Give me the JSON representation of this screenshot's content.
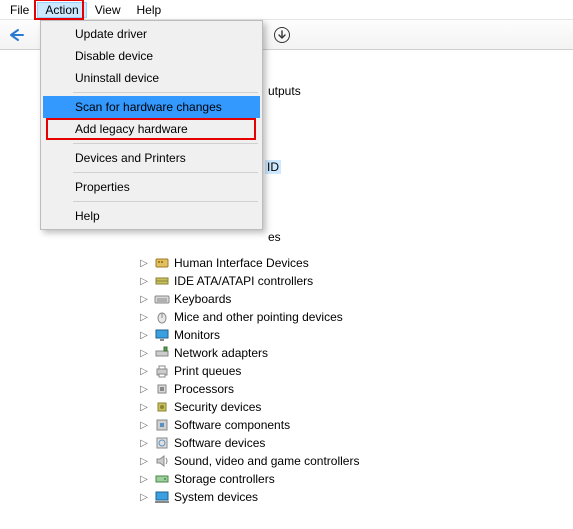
{
  "menubar": {
    "file": "File",
    "action": "Action",
    "view": "View",
    "help": "Help"
  },
  "dropdown": {
    "update": "Update driver",
    "disable": "Disable device",
    "uninstall": "Uninstall device",
    "scan": "Scan for hardware changes",
    "addlegacy": "Add legacy hardware",
    "devprint": "Devices and Printers",
    "properties": "Properties",
    "help": "Help"
  },
  "peeks": {
    "outputs": "utputs",
    "selected_fragment": "ID",
    "es_suffix": "es"
  },
  "tree": [
    {
      "label": "Human Interface Devices",
      "icon": "hid"
    },
    {
      "label": "IDE ATA/ATAPI controllers",
      "icon": "ide"
    },
    {
      "label": "Keyboards",
      "icon": "keyboard"
    },
    {
      "label": "Mice and other pointing devices",
      "icon": "mouse"
    },
    {
      "label": "Monitors",
      "icon": "monitor"
    },
    {
      "label": "Network adapters",
      "icon": "network"
    },
    {
      "label": "Print queues",
      "icon": "printer"
    },
    {
      "label": "Processors",
      "icon": "cpu"
    },
    {
      "label": "Security devices",
      "icon": "security"
    },
    {
      "label": "Software components",
      "icon": "swcomp"
    },
    {
      "label": "Software devices",
      "icon": "swdev"
    },
    {
      "label": "Sound, video and game controllers",
      "icon": "sound"
    },
    {
      "label": "Storage controllers",
      "icon": "storage"
    },
    {
      "label": "System devices",
      "icon": "system"
    }
  ]
}
